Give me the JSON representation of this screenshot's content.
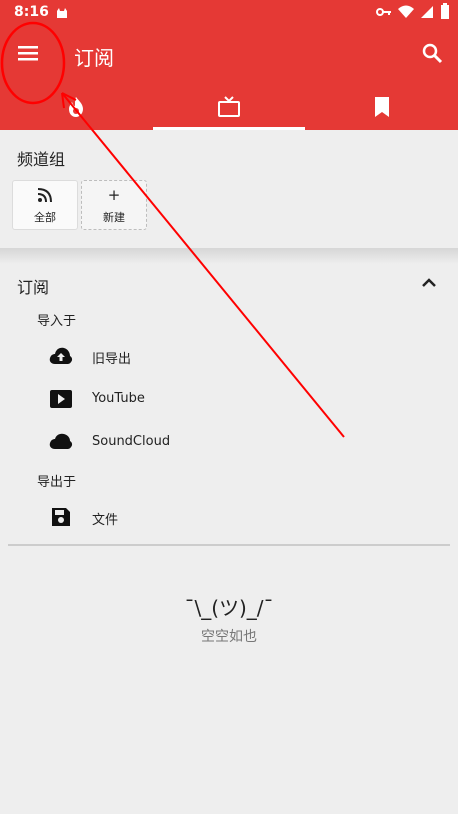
{
  "status": {
    "time": "8:16"
  },
  "toolbar": {
    "title": "订阅"
  },
  "groups": {
    "title": "频道组",
    "all_label": "全部",
    "new_label": "新建",
    "new_plus": "+"
  },
  "subscriptions": {
    "title": "订阅",
    "import_label": "导入于",
    "import_items": [
      "旧导出",
      "YouTube",
      "SoundCloud"
    ],
    "export_label": "导出于",
    "export_items": [
      "文件"
    ]
  },
  "empty": {
    "face": "¯\\_(ツ)_/¯",
    "text": "空空如也"
  },
  "colors": {
    "accent": "#e53935",
    "background": "#eeeeee",
    "annotation": "#ff0000"
  }
}
